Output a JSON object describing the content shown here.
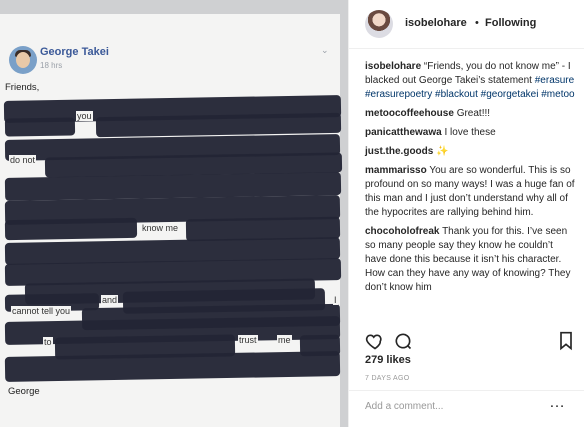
{
  "post_image": {
    "author": "George Takei",
    "timestamp": "18 hrs",
    "greeting": "Friends,",
    "visible_words": [
      "you",
      "do not",
      "know me",
      "and",
      "I",
      "cannot tell you",
      "to",
      "trust",
      "me"
    ],
    "signature": "George",
    "redaction_color": "#232535"
  },
  "post_header": {
    "username": "isobelohare",
    "separator": "•",
    "follow_label": "Following"
  },
  "comments": [
    {
      "user": "isobelohare",
      "text_parts": [
        "“Friends, you do not know me” - I blacked out George Takei’s statement ",
        "#erasure",
        " ",
        "#erasurepoetry",
        " ",
        "#blackout",
        " ",
        "#georgetakei",
        " ",
        "#metoo"
      ]
    },
    {
      "user": "metoocoffeehouse",
      "text": "Great!!!"
    },
    {
      "user": "panicatthewawa",
      "text": "I love these"
    },
    {
      "user": "just.the.goods",
      "text": "✨"
    },
    {
      "user": "mammarisso",
      "text": "You are so wonderful. This is so profound on so many ways! I was a huge fan of this man and I just don’t understand why all of the hypocrites are rallying behind him."
    },
    {
      "user": "chocoholofreak",
      "text": "Thank you for this. I’ve seen so many people say they know he couldn’t have done this because it isn’t his character. How can they have any way of knowing? They don’t know him"
    }
  ],
  "actions": {
    "like_icon": "heart-icon",
    "comment_icon": "comment-icon",
    "save_icon": "bookmark-icon"
  },
  "likes": "279 likes",
  "post_date": "7 DAYS AGO",
  "comment_input": {
    "placeholder": "Add a comment..."
  },
  "more_icon": "ellipsis-icon",
  "colors": {
    "link": "#003569",
    "text": "#262626",
    "muted": "#999999"
  }
}
